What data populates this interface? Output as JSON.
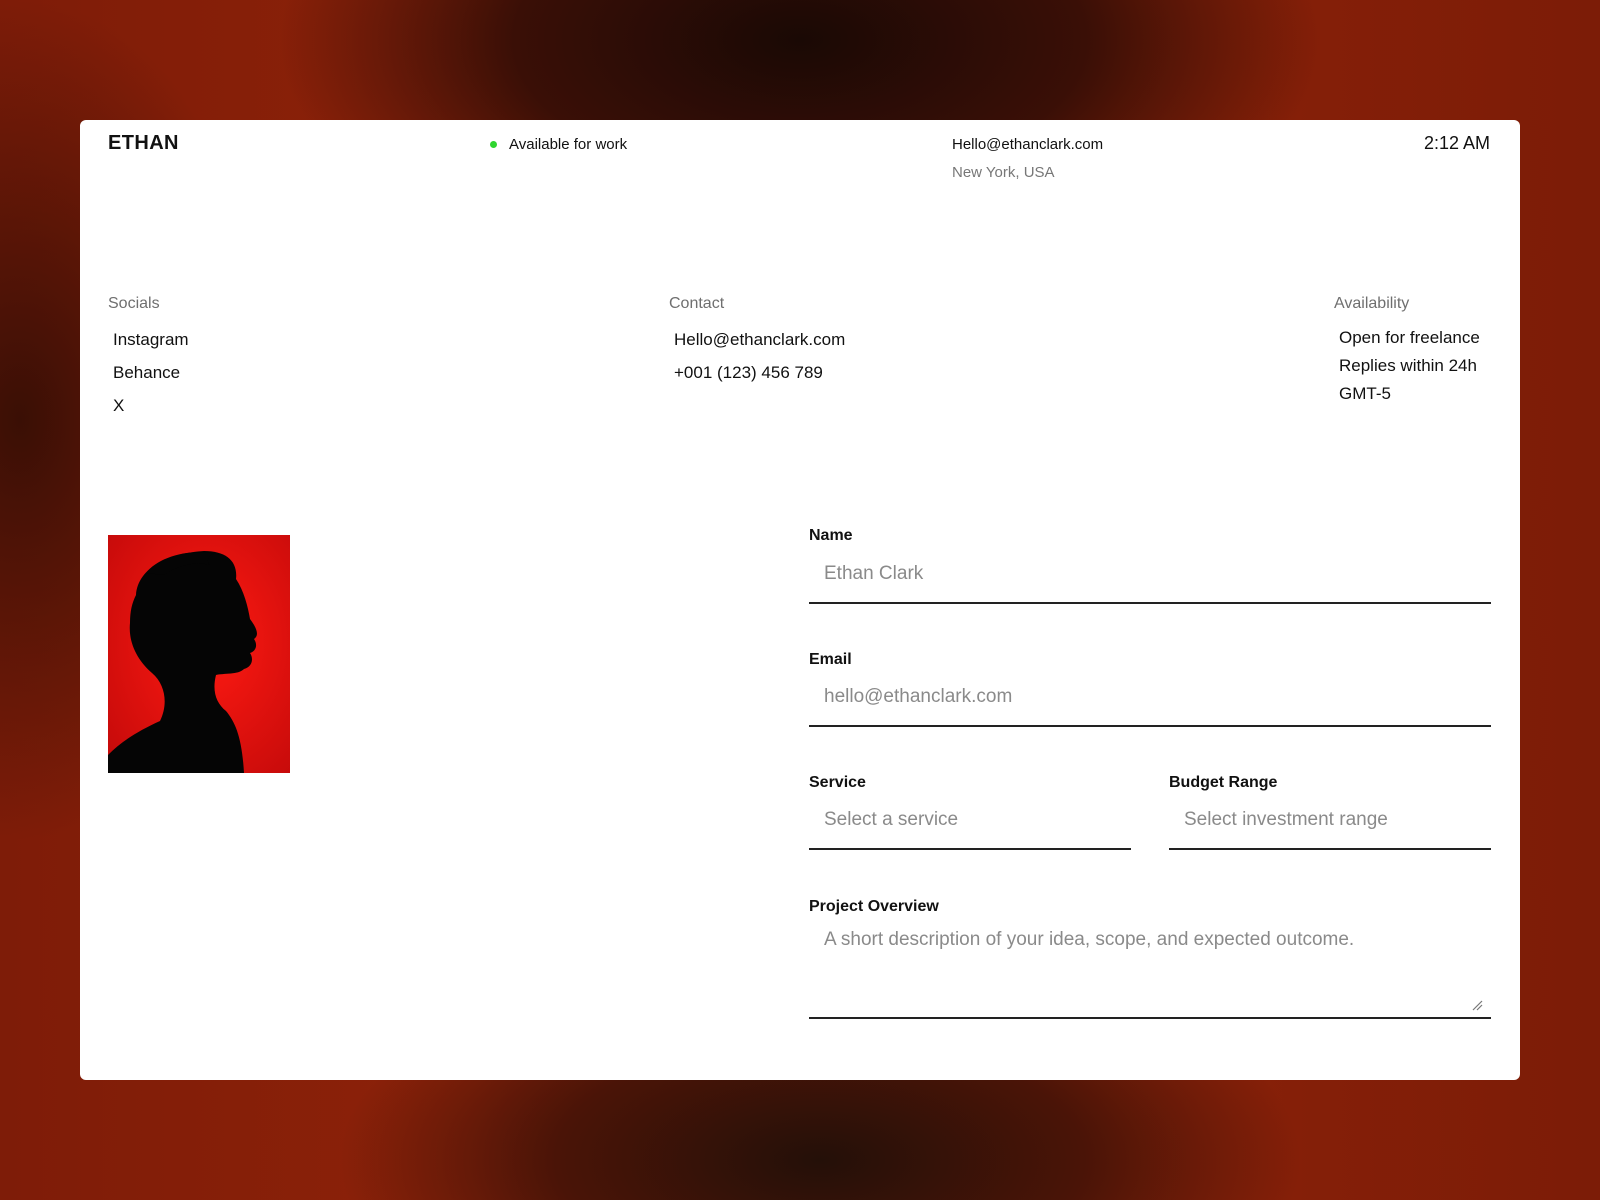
{
  "header": {
    "brand": "ETHAN",
    "status": "Available for work",
    "email": "Hello@ethanclark.com",
    "location": "New York, USA",
    "time": "2:12 AM"
  },
  "socials": {
    "title": "Socials",
    "items": [
      "Instagram",
      "Behance",
      "X"
    ]
  },
  "contact": {
    "title": "Contact",
    "email": "Hello@ethanclark.com",
    "phone": "+001 (123) 456 789"
  },
  "availability": {
    "title": "Availability",
    "items": [
      "Open for freelance",
      "Replies within 24h",
      "GMT-5"
    ]
  },
  "form": {
    "name_label": "Name",
    "name_placeholder": "Ethan Clark",
    "email_label": "Email",
    "email_placeholder": "hello@ethanclark.com",
    "service_label": "Service",
    "service_placeholder": "Select a service",
    "budget_label": "Budget Range",
    "budget_placeholder": "Select investment range",
    "overview_label": "Project Overview",
    "overview_placeholder": "A short description of your idea, scope, and expected outcome."
  },
  "colors": {
    "status_dot": "#2fd52f",
    "portrait_bg": "#e00d0d"
  }
}
